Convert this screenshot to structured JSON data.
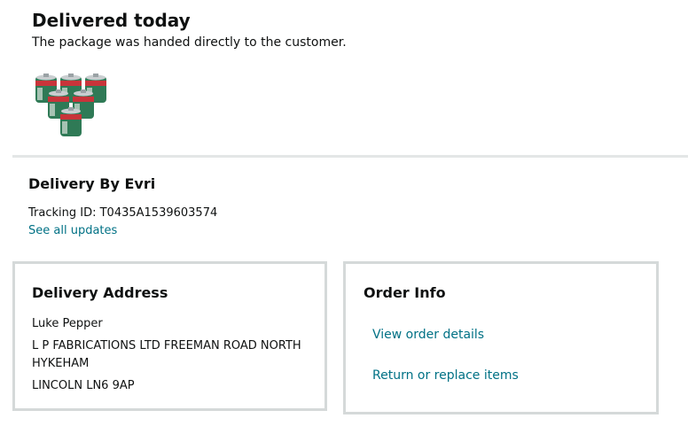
{
  "status": {
    "title": "Delivered today",
    "subtitle": "The package was handed directly to the customer."
  },
  "product_image": {
    "icon": "gas-canister-cluster-image",
    "colors": {
      "body": "#2f7a56",
      "band": "#c8343a",
      "metal": "#c9ced0"
    }
  },
  "carrier": {
    "title": "Delivery By Evri",
    "tracking": "Tracking ID: T0435A1539603574",
    "see_all_updates": "See all updates"
  },
  "delivery_address": {
    "title": "Delivery Address",
    "name": "Luke Pepper",
    "street": "L P FABRICATIONS LTD FREEMAN ROAD NORTH HYKEHAM",
    "city": "LINCOLN LN6 9AP"
  },
  "order_info": {
    "title": "Order Info",
    "view_details": "View order details",
    "return_replace": "Return or replace items"
  },
  "colors": {
    "link": "#007185",
    "text": "#0f1111",
    "border": "#d5d9d9"
  }
}
